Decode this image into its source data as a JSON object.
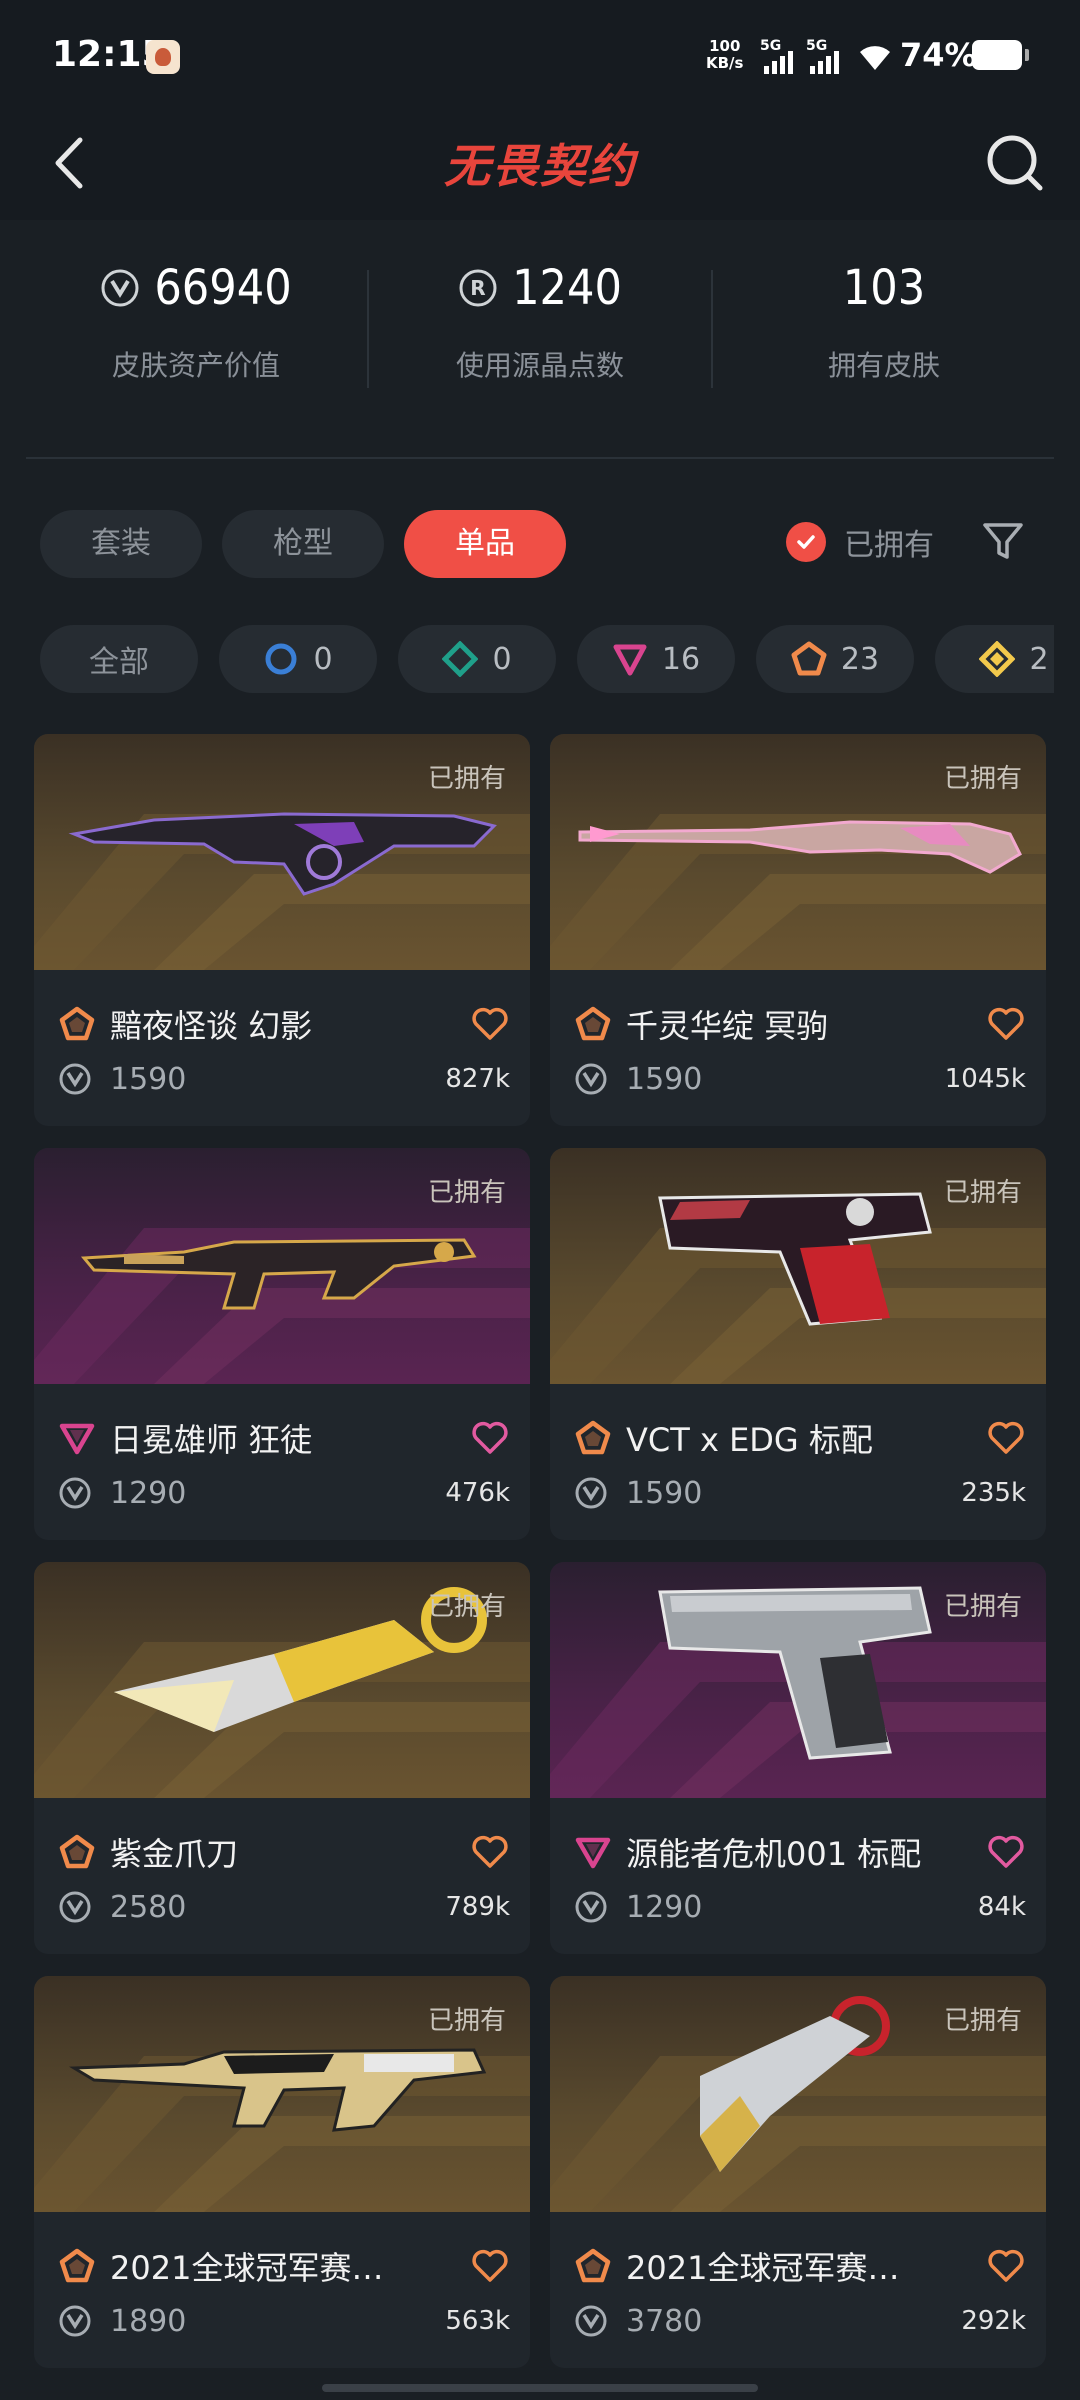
{
  "status_bar": {
    "time": "12:15",
    "net_speed": "100",
    "net_unit": "KB/s",
    "sig1": "5G",
    "sig2": "5G",
    "battery": "74%"
  },
  "header": {
    "title": "无畏契约",
    "back_icon": "chevron-left-icon",
    "search_icon": "search-icon"
  },
  "stats": [
    {
      "value": "66940",
      "label": "皮肤资产价值",
      "icon": "vp-coin-icon"
    },
    {
      "value": "1240",
      "label": "使用源晶点数",
      "icon": "radianite-icon"
    },
    {
      "value": "103",
      "label": "拥有皮肤",
      "icon": ""
    }
  ],
  "filters": {
    "tabs": [
      "套装",
      "枪型",
      "单品"
    ],
    "active_tab": "单品",
    "owned_label": "已拥有"
  },
  "tiers": [
    {
      "label": "全部",
      "count": "",
      "icon": ""
    },
    {
      "label": "",
      "count": "0",
      "icon": "select-tier-icon",
      "color": "#3a7fd6"
    },
    {
      "label": "",
      "count": "0",
      "icon": "deluxe-tier-icon",
      "color": "#1fa08a"
    },
    {
      "label": "",
      "count": "16",
      "icon": "premium-tier-icon",
      "color": "#d9448f"
    },
    {
      "label": "",
      "count": "23",
      "icon": "exclusive-tier-icon",
      "color": "#f08a4b"
    },
    {
      "label": "",
      "count": "2",
      "icon": "ultra-tier-icon",
      "color": "#f2c94c"
    }
  ],
  "cards": [
    {
      "owned": "已拥有",
      "name": "黯夜怪谈 幻影",
      "price": "1590",
      "likes": "827k",
      "tier": "exclusive",
      "bg": "gold",
      "weapon": "rifle-dark"
    },
    {
      "owned": "已拥有",
      "name": "千灵华绽 冥驹",
      "price": "1590",
      "likes": "1045k",
      "tier": "exclusive",
      "bg": "gold",
      "weapon": "sniper-pink"
    },
    {
      "owned": "已拥有",
      "name": "日冕雄师 狂徒",
      "price": "1290",
      "likes": "476k",
      "tier": "premium",
      "bg": "purple",
      "weapon": "rifle-gold"
    },
    {
      "owned": "已拥有",
      "name": "VCT x EDG 标配",
      "price": "1590",
      "likes": "235k",
      "tier": "exclusive",
      "bg": "gold",
      "weapon": "pistol-red"
    },
    {
      "owned": "已拥有",
      "name": "紫金爪刀",
      "price": "2580",
      "likes": "789k",
      "tier": "exclusive",
      "bg": "gold",
      "weapon": "karambit-gold"
    },
    {
      "owned": "已拥有",
      "name": "源能者危机001 标配",
      "price": "1290",
      "likes": "84k",
      "tier": "premium",
      "bg": "purple",
      "weapon": "pistol-gray"
    },
    {
      "owned": "已拥有",
      "name": "2021全球冠军赛…",
      "price": "1890",
      "likes": "563k",
      "tier": "exclusive",
      "bg": "gold",
      "weapon": "rifle-champ"
    },
    {
      "owned": "已拥有",
      "name": "2021全球冠军赛…",
      "price": "3780",
      "likes": "292k",
      "tier": "exclusive",
      "bg": "gold",
      "weapon": "karambit-champ"
    }
  ],
  "colors": {
    "accent": "#f04f46",
    "exclusive": "#f08a4b",
    "premium": "#d9448f",
    "heart_exclusive": "#f08a4b",
    "heart_premium": "#e25aa0"
  }
}
